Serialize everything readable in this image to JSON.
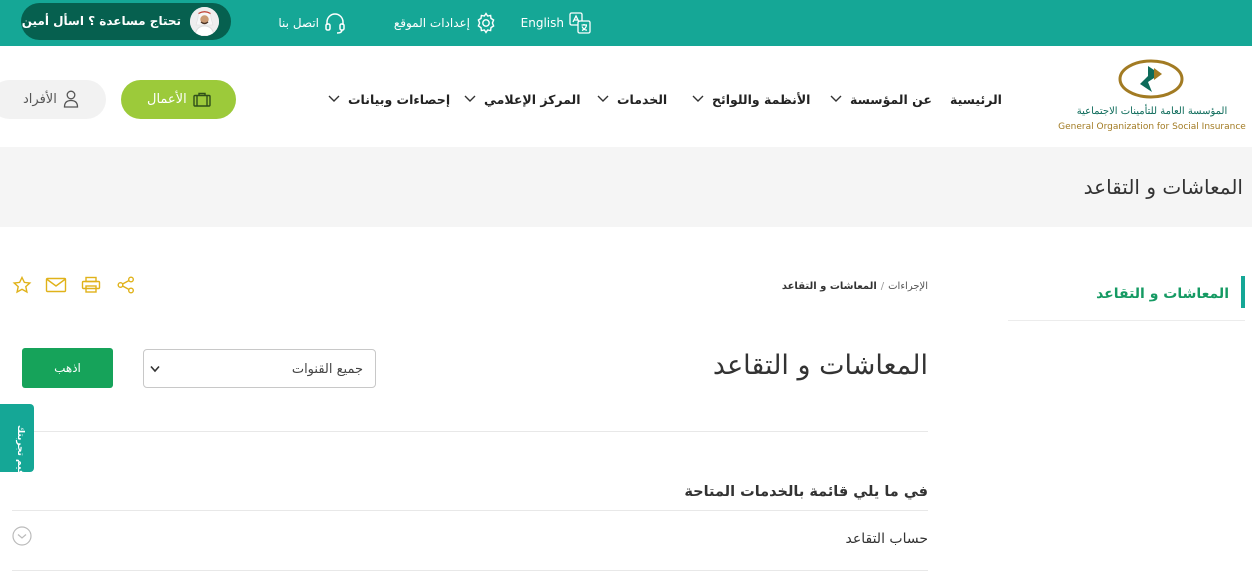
{
  "topbar": {
    "help_text": "تحتاج مساعدة ؟ اسأل أمين",
    "contact_label": "اتصل بنا",
    "settings_label": "إعدادات الموقع",
    "language_label": "English"
  },
  "header": {
    "logo_ar": "المؤسسة العامة للتأمينات الاجتماعية",
    "logo_en": "General Organization for Social Insurance",
    "nav": [
      {
        "label": "الرئيسية"
      },
      {
        "label": "عن المؤسسة"
      },
      {
        "label": "الأنظمة واللوائح"
      },
      {
        "label": "الخدمات"
      },
      {
        "label": "المركز الإعلامي"
      },
      {
        "label": "إحصاءات وبيانات"
      }
    ],
    "business_label": "الأعمال",
    "individuals_label": "الأفراد"
  },
  "page": {
    "band_title": "المعاشات و التقاعد"
  },
  "sidebar": {
    "items": [
      {
        "label": "المعاشات و التقاعد",
        "active": true
      }
    ]
  },
  "breadcrumb": {
    "parent": "الإجراءات",
    "current": "المعاشات و التقاعد"
  },
  "main": {
    "title": "المعاشات و التقاعد",
    "channel_select": {
      "value": "جميع القنوات"
    },
    "go_label": "اذهب",
    "list_heading": "في ما يلي قائمة بالخدمات المتاحة",
    "services": [
      {
        "label": "حساب التقاعد"
      }
    ]
  },
  "feedback": {
    "label": "قيم تجربتك"
  },
  "colors": {
    "topbar": "#15a796",
    "help_pill": "#06604f",
    "business_button": "#9cca3a",
    "go_button": "#16a35a",
    "active_sidebar_text": "#159a63",
    "tool_icons": "#e0b21a"
  }
}
